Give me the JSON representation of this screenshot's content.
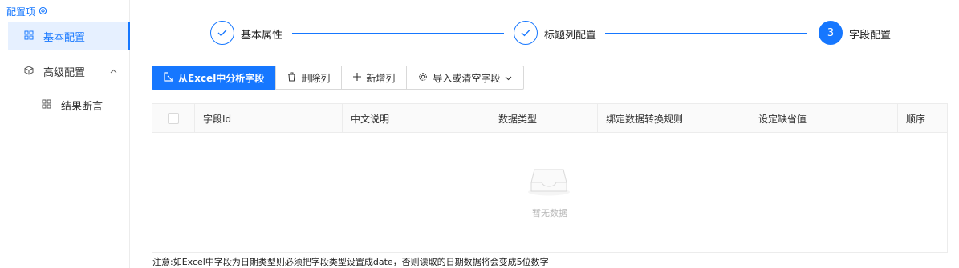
{
  "sidebar": {
    "header": "配置项",
    "items": [
      {
        "label": "基本配置",
        "icon": "grid-icon",
        "active": true
      },
      {
        "label": "高级配置",
        "icon": "cube-icon",
        "expandable": true
      },
      {
        "label": "结果断言",
        "icon": "grid-icon"
      }
    ]
  },
  "steps": [
    {
      "label": "基本属性",
      "status": "done"
    },
    {
      "label": "标题列配置",
      "status": "done"
    },
    {
      "label": "字段配置",
      "number": "3",
      "status": "current"
    }
  ],
  "toolbar": {
    "analyze_label": "从Excel中分析字段",
    "delete_label": "删除列",
    "add_label": "新增列",
    "import_label": "导入或清空字段"
  },
  "table": {
    "columns": [
      "字段Id",
      "中文说明",
      "数据类型",
      "绑定数据转换规则",
      "设定缺省值",
      "顺序"
    ],
    "empty_text": "暂无数据"
  },
  "note": "注意:如Excel中字段为日期类型则必须把字段类型设置成date，否则读取的日期数据将会变成5位数字",
  "colors": {
    "accent": "#1677ff",
    "active_bg": "#e6f0ff"
  }
}
